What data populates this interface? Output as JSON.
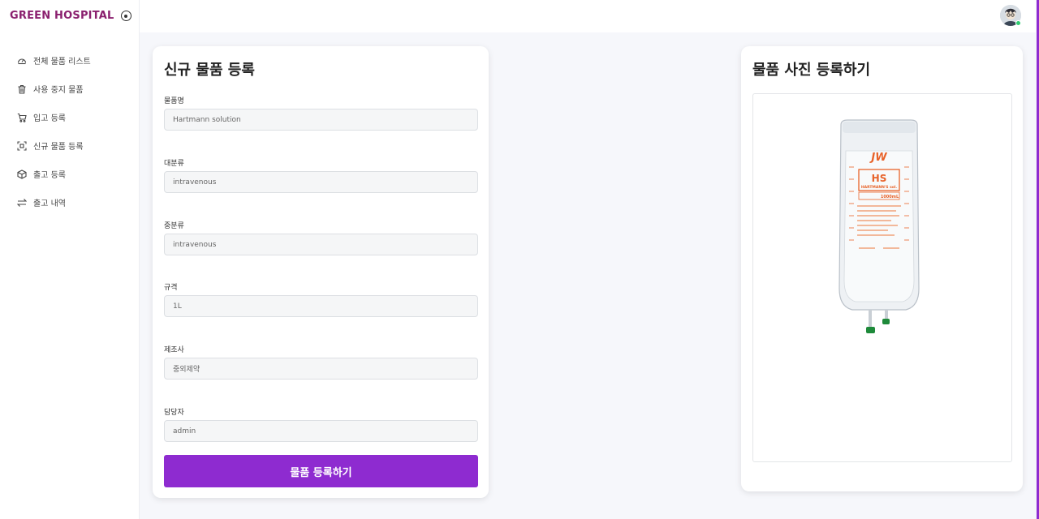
{
  "brand": {
    "name": "GREEN HOSPITAL"
  },
  "sidebar": {
    "items": [
      {
        "label": "전체 물품 리스트",
        "icon": "gauge-icon"
      },
      {
        "label": "사용 중지 물품",
        "icon": "trash-icon"
      },
      {
        "label": "입고 등록",
        "icon": "cart-icon"
      },
      {
        "label": "신규 물품 등록",
        "icon": "scan-icon"
      },
      {
        "label": "출고 등록",
        "icon": "box-icon"
      },
      {
        "label": "출고 내역",
        "icon": "swap-arrows-icon"
      }
    ]
  },
  "form": {
    "title": "신규 물품 등록",
    "fields": [
      {
        "label": "물품명",
        "value": "Hartmann solution"
      },
      {
        "label": "대분류",
        "value": "intravenous"
      },
      {
        "label": "중분류",
        "value": "intravenous"
      },
      {
        "label": "규격",
        "value": "1L"
      },
      {
        "label": "제조사",
        "value": "중외제약"
      },
      {
        "label": "담당자",
        "value": "admin"
      }
    ],
    "submit_label": "물품 등록하기"
  },
  "photo": {
    "title": "물품 사진 등록하기",
    "bag": {
      "logo": "JW",
      "code": "HS",
      "name": "HARTMANN'S sol.",
      "volume": "1000mL"
    }
  },
  "colors": {
    "accent": "#8e2bd0",
    "brand": "#8a1f6e",
    "online": "#2ecc71",
    "bag_print": "#e8632a"
  }
}
